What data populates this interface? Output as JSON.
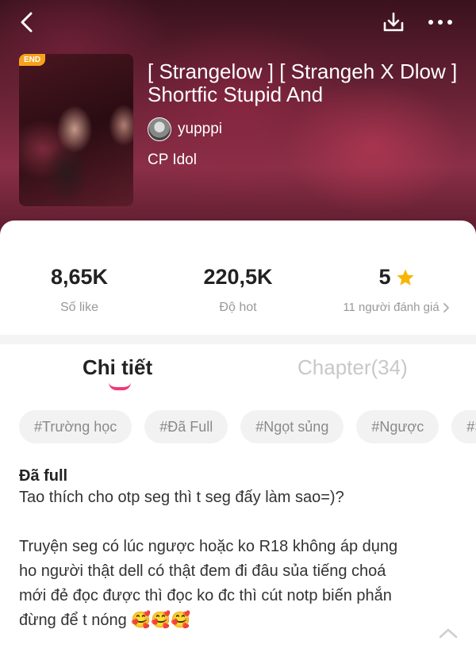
{
  "header": {
    "back_icon": "chevron-left-icon",
    "download_icon": "download-icon",
    "more_icon": "more-dots-icon"
  },
  "story": {
    "badge": "END",
    "title": "[ Strangelow ] [ Strangeh X Dlow ] Shortfic Stupid And",
    "author": "yupppi",
    "category": "CP Idol"
  },
  "stats": {
    "likes": "8,65K",
    "likes_label": "Số like",
    "hot": "220,5K",
    "hot_label": "Độ hot",
    "rating": "5",
    "rating_label": "11 người đánh giá",
    "star_color": "#f7b500"
  },
  "tabs": [
    {
      "label": "Chi tiết",
      "active": true
    },
    {
      "label": "Chapter(34)",
      "active": false
    }
  ],
  "tags": [
    "#Trường học",
    "#Đã Full",
    "#Ngọt sủng",
    "#Ngược",
    "#Sh"
  ],
  "description": {
    "heading": "Đã full",
    "line1": "Tao thích cho otp seg thì t seg đấy làm sao=)?",
    "line2": "Truyện seg có lúc ngược hoặc ko R18 không áp dụng",
    "line3": "ho người thật dell có thật đem đi đâu sủa tiếng choá",
    "line4": "mới đẻ đọc được thì đọc ko đc thì cút notp biến phắn",
    "line5": "đừng để t nóng 🥰🥰🥰"
  },
  "colors": {
    "accent": "#f2387a",
    "badge": "#f7a21b"
  }
}
